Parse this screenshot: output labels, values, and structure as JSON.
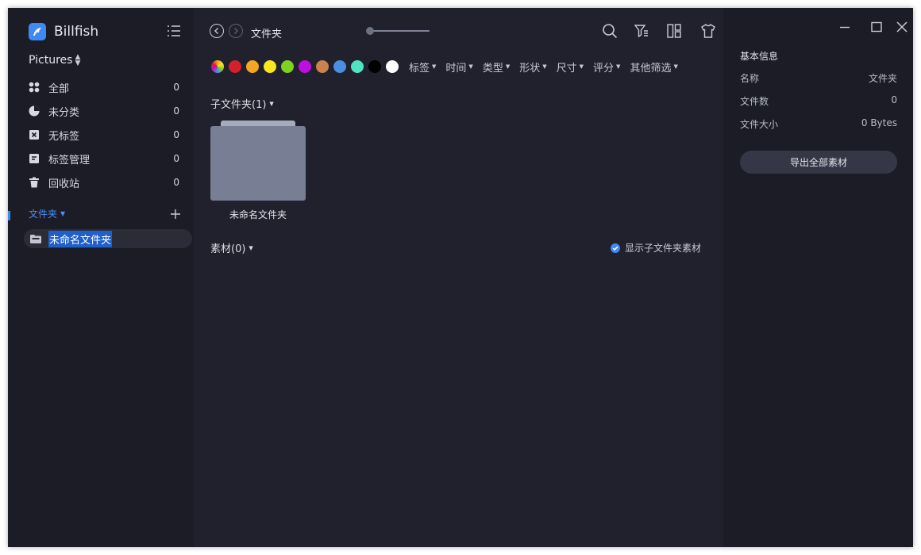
{
  "app": {
    "name": "Billfish"
  },
  "sidebar": {
    "library": "Pictures",
    "nav": [
      {
        "label": "全部",
        "count": "0",
        "icon": "grid-icon"
      },
      {
        "label": "未分类",
        "count": "0",
        "icon": "pie-icon"
      },
      {
        "label": "无标签",
        "count": "0",
        "icon": "no-tag-icon"
      },
      {
        "label": "标签管理",
        "count": "0",
        "icon": "tag-manage-icon"
      },
      {
        "label": "回收站",
        "count": "0",
        "icon": "trash-icon"
      }
    ],
    "folders_header": "文件夹",
    "folders": [
      {
        "name": "未命名文件夹"
      }
    ]
  },
  "main": {
    "breadcrumb": "文件夹",
    "color_filters": [
      "#d2212a",
      "#f5a623",
      "#f8e71c",
      "#7ed321",
      "#bd10e0",
      "#c8844c",
      "#4a90e2",
      "#50e3c2",
      "#000000",
      "#ffffff"
    ],
    "filters": [
      "标签",
      "时间",
      "类型",
      "形状",
      "尺寸",
      "评分",
      "其他筛选"
    ],
    "subfolders_title": "子文件夹(1)",
    "subfolders": [
      {
        "name": "未命名文件夹"
      }
    ],
    "assets_title": "素材(0)",
    "show_sub_label": "显示子文件夹素材"
  },
  "panel": {
    "title": "基本信息",
    "rows": [
      {
        "key": "名称",
        "value": "文件夹"
      },
      {
        "key": "文件数",
        "value": "0"
      },
      {
        "key": "文件大小",
        "value": "0 Bytes"
      }
    ],
    "export_label": "导出全部素材"
  },
  "colors": {
    "accent": "#3d8af7",
    "bg_main": "#20212c",
    "bg_side": "#1b1c26"
  }
}
